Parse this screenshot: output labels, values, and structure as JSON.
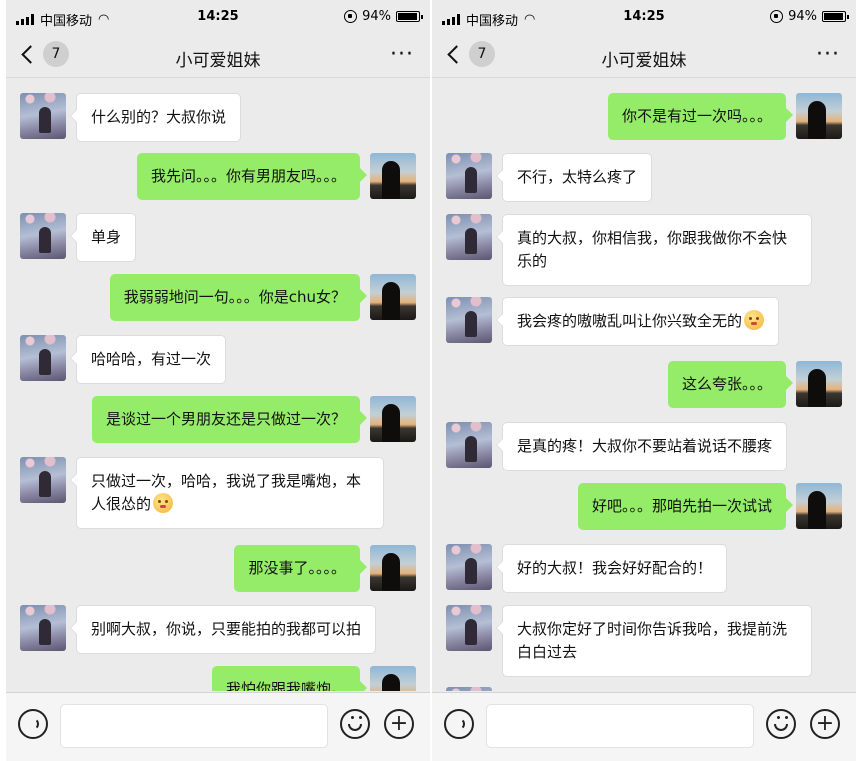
{
  "status_bar": {
    "carrier": "中国移动",
    "time": "14:25",
    "battery": "94%"
  },
  "left_screen": {
    "nav": {
      "unread_count": "7",
      "title": "小可爱姐妹",
      "more": "···"
    },
    "messages": [
      {
        "side": "left",
        "text": "什么别的？大叔你说"
      },
      {
        "side": "right",
        "text": "我先问。。。你有男朋友吗。。。"
      },
      {
        "side": "left",
        "text": "单身"
      },
      {
        "side": "right",
        "text": "我弱弱地问一句。。。你是chu女？"
      },
      {
        "side": "left",
        "text": "哈哈哈，有过一次"
      },
      {
        "side": "right",
        "text": "是谈过一个男朋友还是只做过一次？"
      },
      {
        "side": "left",
        "text": "只做过一次，哈哈，我说了我是嘴炮，本人很怂的",
        "line2": "人很怂的",
        "line1": "只做过一次，哈哈，我说了我是嘴炮，本"
      },
      {
        "side": "right",
        "text": "那没事了。。。。"
      },
      {
        "side": "left",
        "text": "别啊大叔，你说，只要能拍的我都可以拍"
      },
      {
        "side": "right",
        "text": "我怕你跟我嘴炮。"
      }
    ]
  },
  "right_screen": {
    "nav": {
      "unread_count": "7",
      "title": "小可爱姐妹",
      "more": "···"
    },
    "messages": [
      {
        "side": "right",
        "text": "你不是有过一次吗。。。"
      },
      {
        "side": "left",
        "text": "不行，太特么疼了"
      },
      {
        "side": "left",
        "line1": "真的大叔，你相信我，你跟我做你不会快",
        "line2": "乐的"
      },
      {
        "side": "left",
        "text": "我会疼的嗷嗷乱叫让你兴致全无的"
      },
      {
        "side": "right",
        "text": "这么夸张。。。"
      },
      {
        "side": "left",
        "text": "是真的疼！大叔你不要站着说话不腰疼"
      },
      {
        "side": "right",
        "text": "好吧。。。那咱先拍一次试试"
      },
      {
        "side": "left",
        "text": "好的大叔！我会好好配合的！"
      },
      {
        "side": "left",
        "line1": "大叔你定好了时间你告诉我哈，我提前洗",
        "line2": "白白过去"
      }
    ]
  },
  "colors": {
    "chat_bg": "#ebebeb",
    "sent_bubble": "#95ec69",
    "received_bubble": "#ffffff"
  },
  "icons": {
    "back": "chevron-left-icon",
    "more": "more-dots-icon",
    "voice": "voice-icon",
    "emoji": "emoji-icon",
    "add": "plus-icon"
  }
}
